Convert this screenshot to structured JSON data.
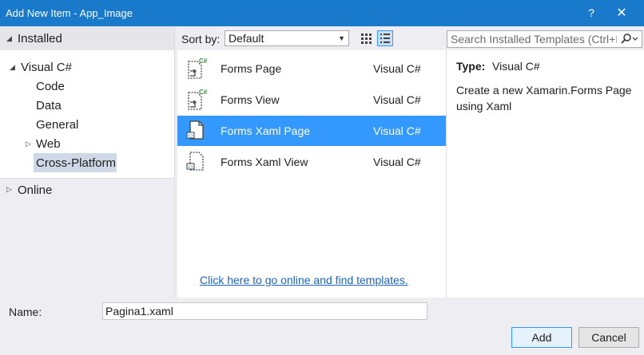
{
  "window": {
    "title": "Add New Item - App_Image",
    "help": "?",
    "close": "✕"
  },
  "tree": {
    "installed": "Installed",
    "visual_csharp": "Visual C#",
    "items": [
      "Code",
      "Data",
      "General",
      "Web",
      "Cross-Platform"
    ],
    "selected": "Cross-Platform",
    "online": "Online"
  },
  "toolbar": {
    "sort_label": "Sort by:",
    "sort_value": "Default",
    "search_placeholder": "Search Installed Templates (Ctrl+E)"
  },
  "templates": [
    {
      "name": "Forms Page",
      "language": "Visual C#",
      "icon": "forms-page-csharp-icon"
    },
    {
      "name": "Forms View",
      "language": "Visual C#",
      "icon": "forms-view-csharp-icon"
    },
    {
      "name": "Forms Xaml Page",
      "language": "Visual C#",
      "icon": "xaml-page-icon",
      "selected": true
    },
    {
      "name": "Forms Xaml View",
      "language": "Visual C#",
      "icon": "xaml-view-icon"
    }
  ],
  "online_link": "Click here to go online and find templates.",
  "details": {
    "type_label": "Type:",
    "type_value": "Visual C#",
    "description": "Create a new Xamarin.Forms Page using Xaml"
  },
  "bottom": {
    "name_label": "Name:",
    "name_value": "Pagina1.xaml",
    "add": "Add",
    "cancel": "Cancel"
  },
  "colors": {
    "titlebar": "#1979ca",
    "selection": "#3399ff",
    "link": "#1a65c0"
  }
}
